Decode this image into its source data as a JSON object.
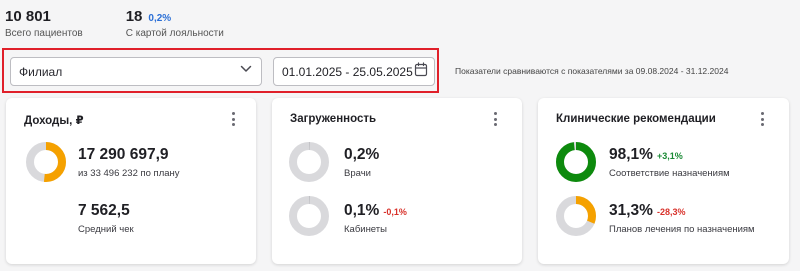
{
  "stats": [
    {
      "value": "10 801",
      "change": "",
      "label": "Всего пациентов"
    },
    {
      "value": "18",
      "change": "0,2%",
      "label": "С картой лояльности"
    }
  ],
  "filters": {
    "branch_label": "Филиал",
    "date_range": "01.01.2025 - 25.05.2025",
    "compare_note": "Показатели сравниваются с показателями за 09.08.2024 - 31.12.2024"
  },
  "cards": {
    "income": {
      "title": "Доходы, ₽",
      "main_value": "17 290 697,9",
      "main_sub": "из 33 496 232 по плану",
      "main_fraction": 0.516,
      "secondary_value": "7 562,5",
      "secondary_label": "Средний чек"
    },
    "load": {
      "title": "Загруженность",
      "doctors_value": "0,2%",
      "doctors_label": "Врачи",
      "doctors_fraction": 0.002,
      "rooms_value": "0,1%",
      "rooms_delta": "-0,1%",
      "rooms_label": "Кабинеты",
      "rooms_fraction": 0.001
    },
    "clinical": {
      "title": "Клинические рекомендации",
      "compliance_value": "98,1%",
      "compliance_delta": "+3,1%",
      "compliance_label": "Соответствие назначениям",
      "compliance_fraction": 0.981,
      "plans_value": "31,3%",
      "plans_delta": "-28,3%",
      "plans_label": "Планов лечения по назначениям",
      "plans_fraction": 0.313
    }
  },
  "colors": {
    "donut_track": "#d9d9dc",
    "income": "#f5a100",
    "load": "#b8b8bc",
    "compliance": "#0d8a0d",
    "plans": "#f5a100",
    "highlight_frame": "#e0202a",
    "positive": "#1a8a35",
    "negative": "#d8312a",
    "link": "#2b6fd6"
  },
  "icons": {
    "select": "chevron-down-icon",
    "date": "calendar-icon",
    "menu": "kebab-menu-icon"
  }
}
